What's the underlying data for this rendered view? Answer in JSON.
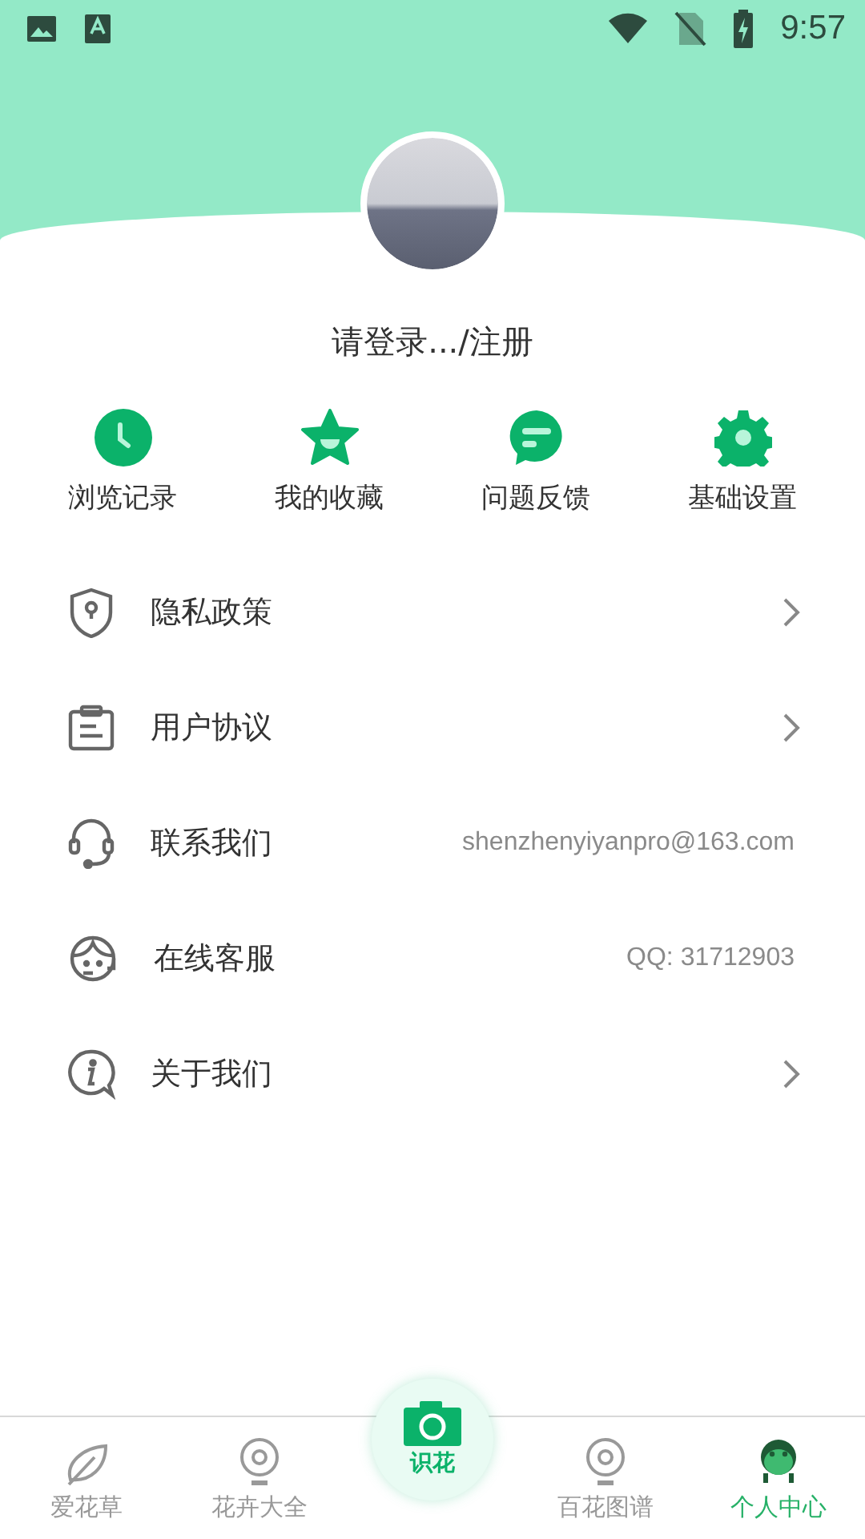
{
  "status_bar": {
    "time": "9:57"
  },
  "profile": {
    "login_text": "请登录.../注册"
  },
  "quick_actions": [
    {
      "label": "浏览记录"
    },
    {
      "label": "我的收藏"
    },
    {
      "label": "问题反馈"
    },
    {
      "label": "基础设置"
    }
  ],
  "menu": [
    {
      "label": "隐私政策",
      "kind": "link"
    },
    {
      "label": "用户协议",
      "kind": "link"
    },
    {
      "label": "联系我们",
      "kind": "info",
      "value": "shenzhenyiyanpro@163.com"
    },
    {
      "label": "在线客服",
      "kind": "info",
      "value": "QQ: 31712903"
    },
    {
      "label": "关于我们",
      "kind": "link"
    }
  ],
  "bottom_nav": [
    {
      "label": "爱花草",
      "kind": "tab",
      "selected": false
    },
    {
      "label": "花卉大全",
      "kind": "tab",
      "selected": false
    },
    {
      "label": "识花",
      "kind": "camera",
      "selected": false
    },
    {
      "label": "百花图谱",
      "kind": "tab",
      "selected": false
    },
    {
      "label": "个人中心",
      "kind": "tab",
      "selected": true
    }
  ]
}
